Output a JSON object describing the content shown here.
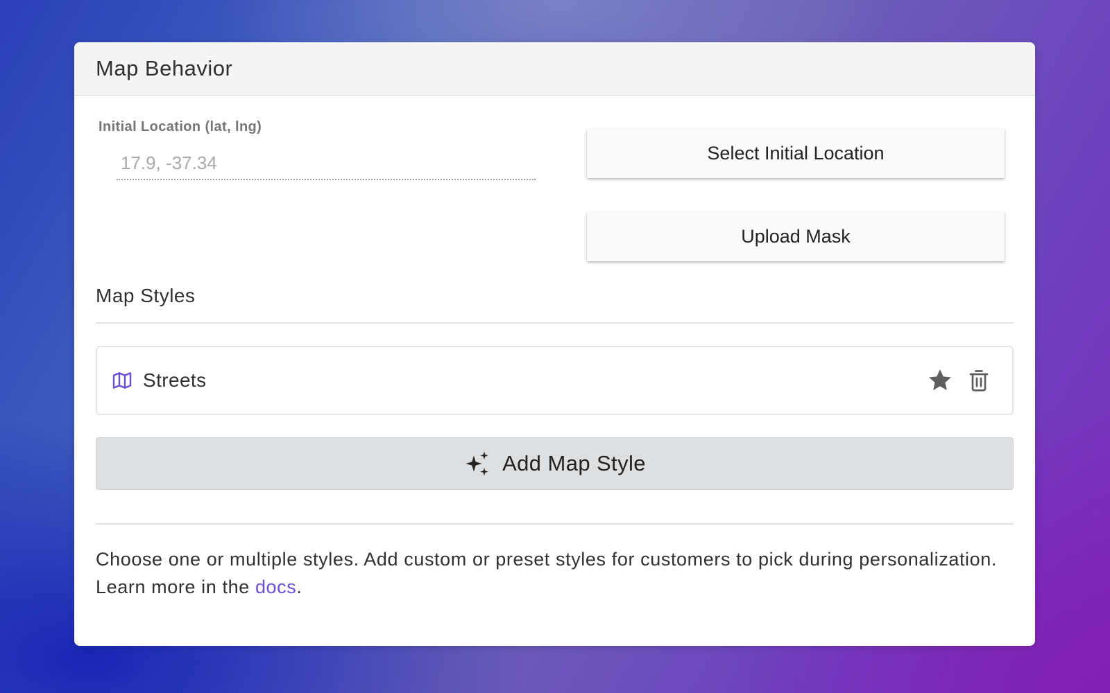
{
  "panel": {
    "title": "Map Behavior"
  },
  "location": {
    "label": "Initial Location (lat, lng)",
    "placeholder": "17.9, -37.34",
    "value": ""
  },
  "actions": {
    "select_location_label": "Select Initial Location",
    "upload_mask_label": "Upload Mask"
  },
  "map_styles": {
    "title": "Map Styles",
    "items": [
      {
        "label": "Streets",
        "icon": "map-icon",
        "favorite_icon": "star-icon",
        "delete_icon": "trash-icon"
      }
    ],
    "add_label": "Add Map Style",
    "add_icon": "sparkles-icon"
  },
  "help": {
    "text_before": "Choose one or multiple styles. Add custom or preset styles for customers to pick during personalization. Learn more in the ",
    "link_label": "docs",
    "text_after": "."
  },
  "colors": {
    "accent": "#6b4fd8",
    "icon_gray": "#5f5f5f",
    "add_button_bg": "#dedfe1"
  }
}
